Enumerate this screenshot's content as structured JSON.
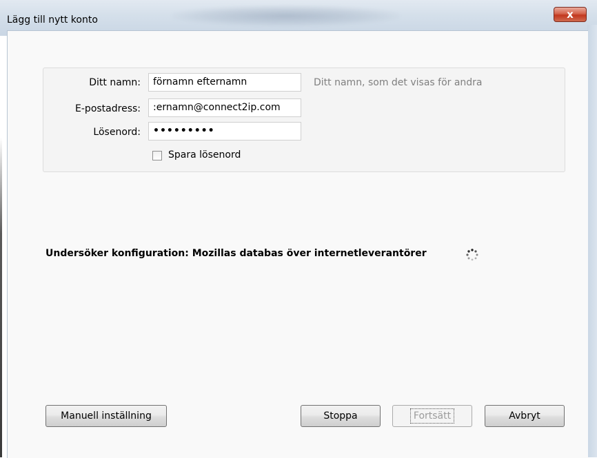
{
  "window": {
    "title": "Lägg till nytt konto",
    "close_label": "x"
  },
  "form": {
    "name_label": "Ditt namn:",
    "name_value": "förnamn efternamn",
    "name_hint": "Ditt namn, som det visas för andra",
    "email_label": "E-postadress:",
    "email_value": ":ernamn@connect2ip.com",
    "password_label": "Lösenord:",
    "password_value": "•••••••••",
    "save_password_label": "Spara lösenord",
    "save_password_checked": false
  },
  "status": {
    "text": "Undersöker konfiguration: Mozillas databas över internetleverantörer",
    "spinner_icon": "loading-spinner-icon"
  },
  "buttons": {
    "manual": "Manuell inställning",
    "stop": "Stoppa",
    "continue": "Fortsätt",
    "cancel": "Avbryt"
  }
}
